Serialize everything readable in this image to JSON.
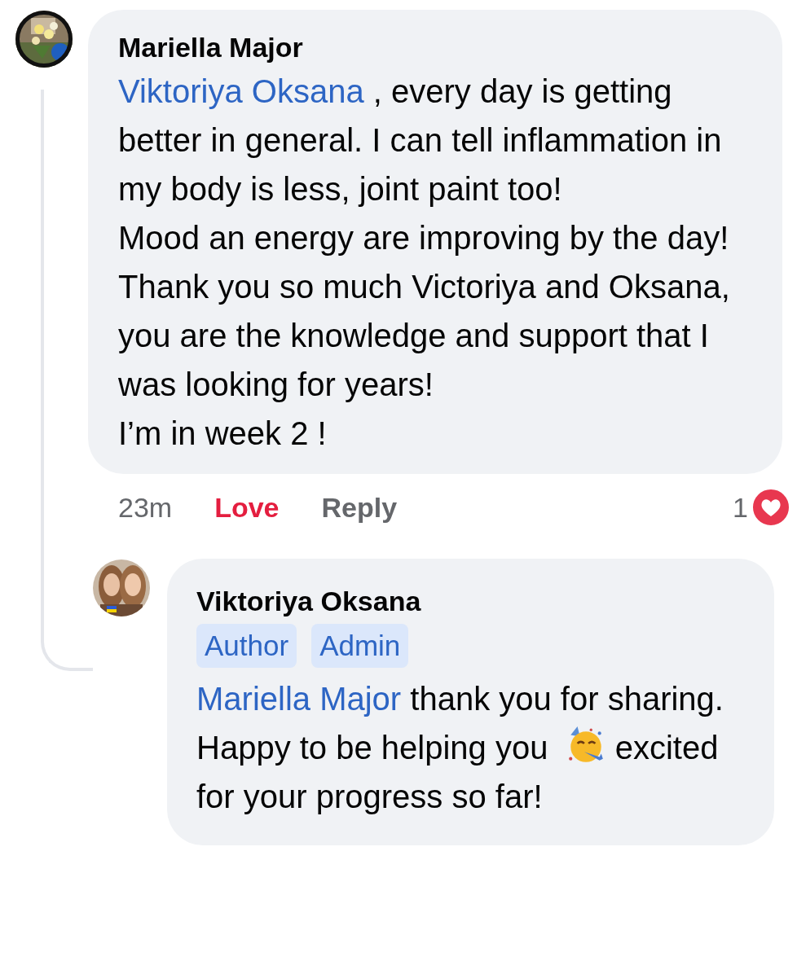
{
  "comment": {
    "author": "Mariella Major",
    "mention": "Viktoriya Oksana",
    "first_text": " , every day is getting better in general. I can tell inflammation in my body is less, joint paint too!",
    "paragraphs": [
      "Mood an energy are improving by the day!",
      "Thank you so much Victoriya and Oksana, you are the knowledge and support that I was looking for years!",
      "I’m in week 2 !"
    ],
    "time": "23m",
    "reaction": {
      "label": "Love",
      "selected": true
    },
    "reply_label": "Reply",
    "reaction_count": "1"
  },
  "reply": {
    "author": "Viktoriya Oksana",
    "badges": [
      "Author",
      "Admin"
    ],
    "mention": "Mariella Major",
    "text_before": " thank you for sharing. Happy to be helping you",
    "text_after": " excited for your progress so far!"
  }
}
